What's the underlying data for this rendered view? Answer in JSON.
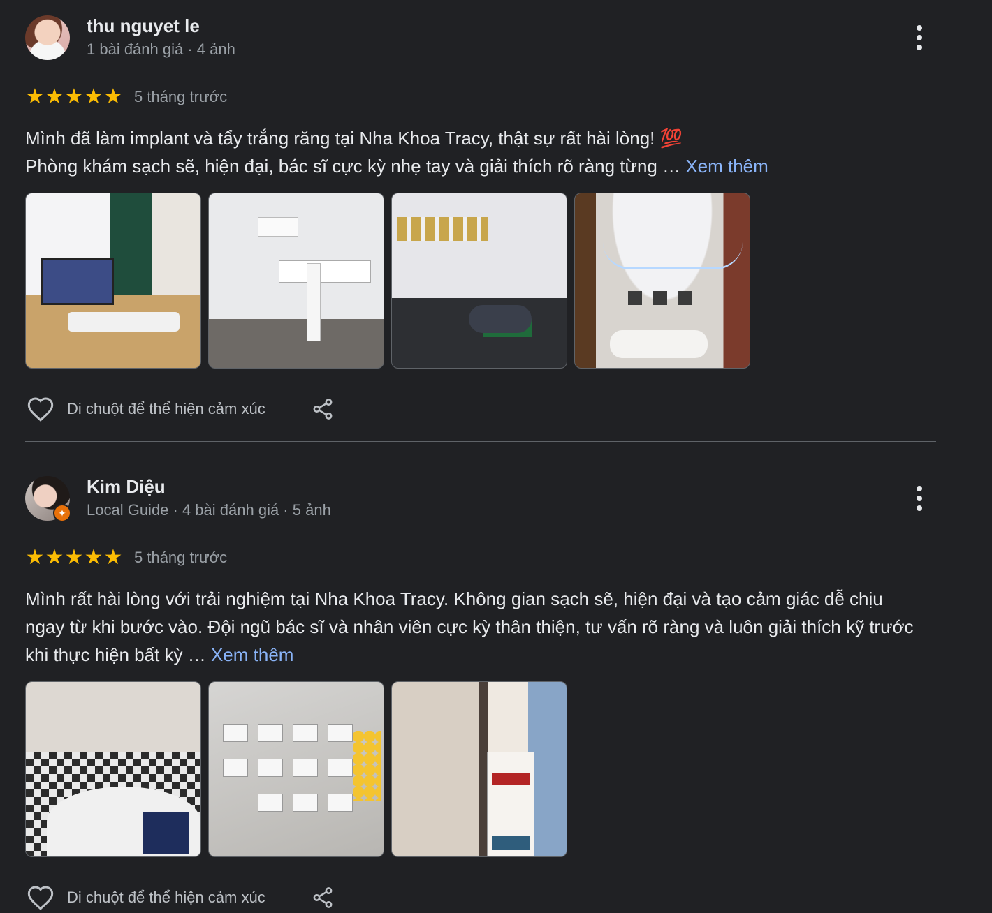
{
  "reviews": [
    {
      "name": "thu nguyet le",
      "meta": "1 bài đánh giá · 4 ảnh",
      "stars": 5,
      "time": "5 tháng trước",
      "text_line1": "Mình đã làm implant và tẩy trắng răng tại Nha Khoa Tracy, thật sự rất hài lòng! 💯",
      "text_line2": "Phòng khám sạch sẽ, hiện đại, bác sĩ cực kỳ nhẹ tay và giải thích rõ ràng từng … ",
      "more_label": "Xem thêm",
      "photo_count": 4,
      "react_label": "Di chuột để thể hiện cảm xúc"
    },
    {
      "name": "Kim Diệu",
      "meta": "Local Guide · 4 bài đánh giá · 5 ảnh",
      "badge": "✦",
      "stars": 5,
      "time": "5 tháng trước",
      "text": "Mình rất hài lòng với trải nghiệm tại Nha Khoa Tracy. Không gian sạch sẽ, hiện đại và tạo cảm giác dễ chịu ngay từ khi bước vào. Đội ngũ bác sĩ và nhân viên cực kỳ thân thiện, tư vấn rõ ràng và luôn giải thích kỹ trước khi thực hiện bất kỳ … ",
      "more_label": "Xem thêm",
      "photo_count": 3,
      "react_label": "Di chuột để thể hiện cảm xúc"
    }
  ],
  "icons": {
    "star": "★",
    "more": "more-vert-icon",
    "heart": "heart-outline-icon",
    "share": "share-icon"
  },
  "colors": {
    "background": "#202124",
    "star": "#fbbc04",
    "link": "#8ab4f8",
    "secondary_text": "#9aa0a6",
    "local_guide_badge": "#e8710a"
  }
}
